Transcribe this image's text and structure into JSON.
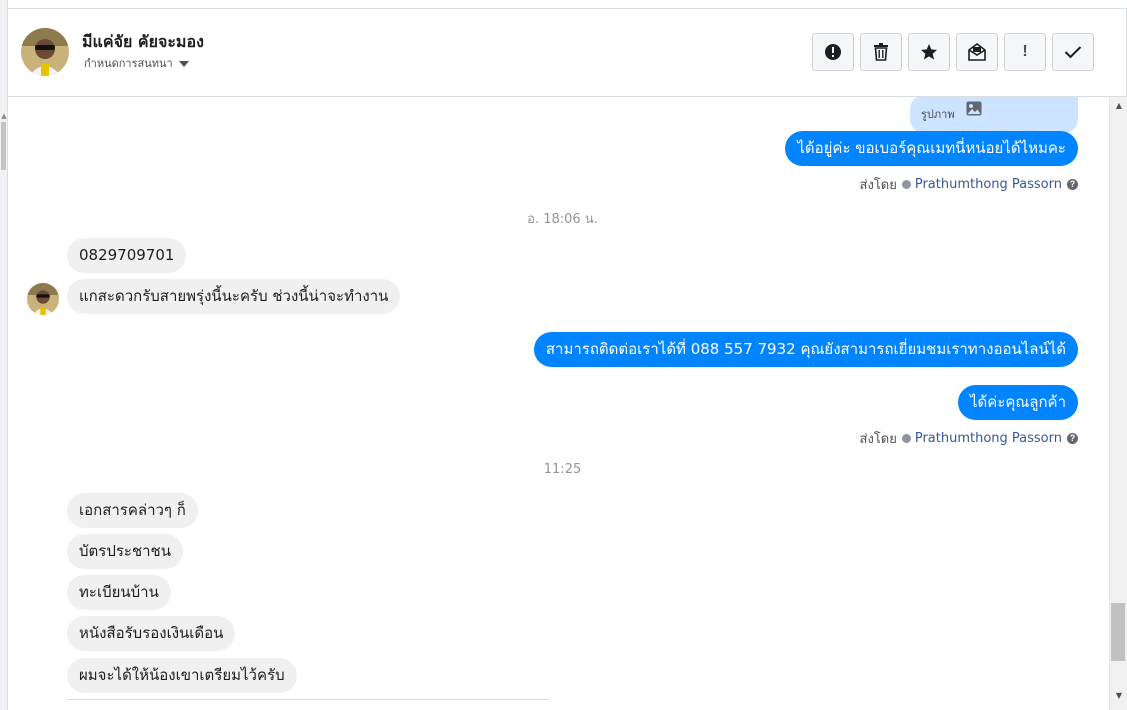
{
  "contact": {
    "name": "มีแค่จัย คัยจะมอง",
    "subtitle": "กำหนดการสนทนา"
  },
  "toolbar": {
    "buttons": [
      {
        "icon": "alert-circle-icon"
      },
      {
        "icon": "trash-icon"
      },
      {
        "icon": "star-icon"
      },
      {
        "icon": "mail-icon"
      },
      {
        "icon": "exclamation-icon",
        "glyph": "!"
      },
      {
        "icon": "check-icon"
      }
    ]
  },
  "thread": {
    "image_chip_label": "รูปภาพ",
    "out_1": "ได้อยู่ค่ะ ขอเบอร์คุณเมทนี่หน่อยได้ไหมคะ",
    "sent_by_label": "ส่งโดย",
    "sent_by_name": "Prathumthong Passorn",
    "help_glyph": "?",
    "timestamp_1": "อ. 18:06 น.",
    "in_1": "0829709701",
    "in_2": "แกสะดวกรับสายพรุ่งนี้นะครับ ช่วงนี้น่าจะทำงาน",
    "out_2": "สามารถติดต่อเราได้ที่ 088 557 7932 คุณยังสามารถเยี่ยมชมเราทางออนไลน์ได้",
    "out_3": "ได้ค่ะคุณลูกค้า",
    "timestamp_2": "11:25",
    "in_3": "เอกสารคล่าวๆ ก็",
    "in_4": "บัตรประชาชน",
    "in_5": "ทะเบียนบ้าน",
    "in_6": "หนังสือรับรองเงินเดือน",
    "in_7": "ผมจะได้ให้น้องเขาเตรียมไว้ครับ"
  },
  "colors": {
    "outgoing_bubble": "#0084ff",
    "incoming_bubble": "#f1f0f0",
    "image_chip": "#cce4ff",
    "link_name": "#385898"
  }
}
